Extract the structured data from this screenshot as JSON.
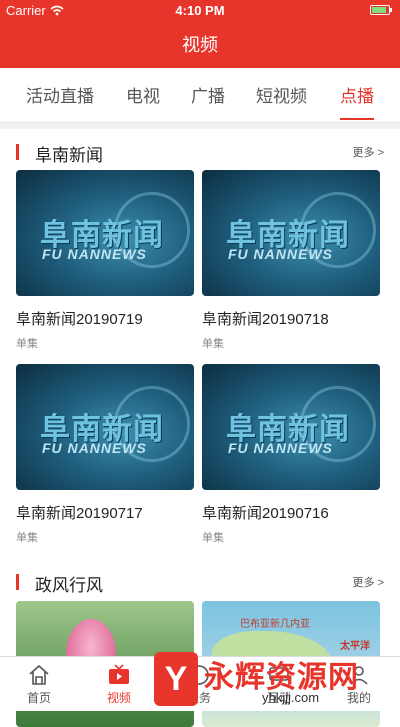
{
  "status_bar": {
    "carrier": "Carrier",
    "time": "4:10 PM"
  },
  "nav": {
    "title": "视频"
  },
  "tabs": [
    {
      "label": "活动直播"
    },
    {
      "label": "电视"
    },
    {
      "label": "广播"
    },
    {
      "label": "短视频"
    },
    {
      "label": "点播",
      "active": true
    }
  ],
  "sections": [
    {
      "title": "阜南新闻",
      "more": "更多 >",
      "items": [
        {
          "title": "阜南新闻20190719",
          "sub": "单集",
          "thumb_cn": "阜南新闻",
          "thumb_en": "FU NANNEWS"
        },
        {
          "title": "阜南新闻20190718",
          "sub": "单集",
          "thumb_cn": "阜南新闻",
          "thumb_en": "FU NANNEWS"
        },
        {
          "title": "阜南新闻20190717",
          "sub": "单集",
          "thumb_cn": "阜南新闻",
          "thumb_en": "FU NANNEWS"
        },
        {
          "title": "阜南新闻20190716",
          "sub": "单集",
          "thumb_cn": "阜南新闻",
          "thumb_en": "FU NANNEWS"
        }
      ]
    },
    {
      "title": "政风行风",
      "more": "更多 >",
      "items": [
        {
          "thumb": "lotus"
        },
        {
          "thumb": "map",
          "thumb_text1": "巴布亚新几内亚",
          "thumb_text2": "太平洋"
        }
      ]
    }
  ],
  "tabbar": [
    {
      "label": "首页",
      "icon": "home-icon"
    },
    {
      "label": "视频",
      "icon": "tv-icon",
      "active": true
    },
    {
      "label": "服务",
      "icon": "service-icon"
    },
    {
      "label": "互动",
      "icon": "interact-icon"
    },
    {
      "label": "我的",
      "icon": "user-icon"
    }
  ],
  "watermark": {
    "logo": "Y",
    "text": "永辉资源网",
    "url": "yhkjjj.com"
  },
  "colors": {
    "brand_red": "#e8352b",
    "text_dark": "#222222",
    "text_muted": "#888888"
  }
}
